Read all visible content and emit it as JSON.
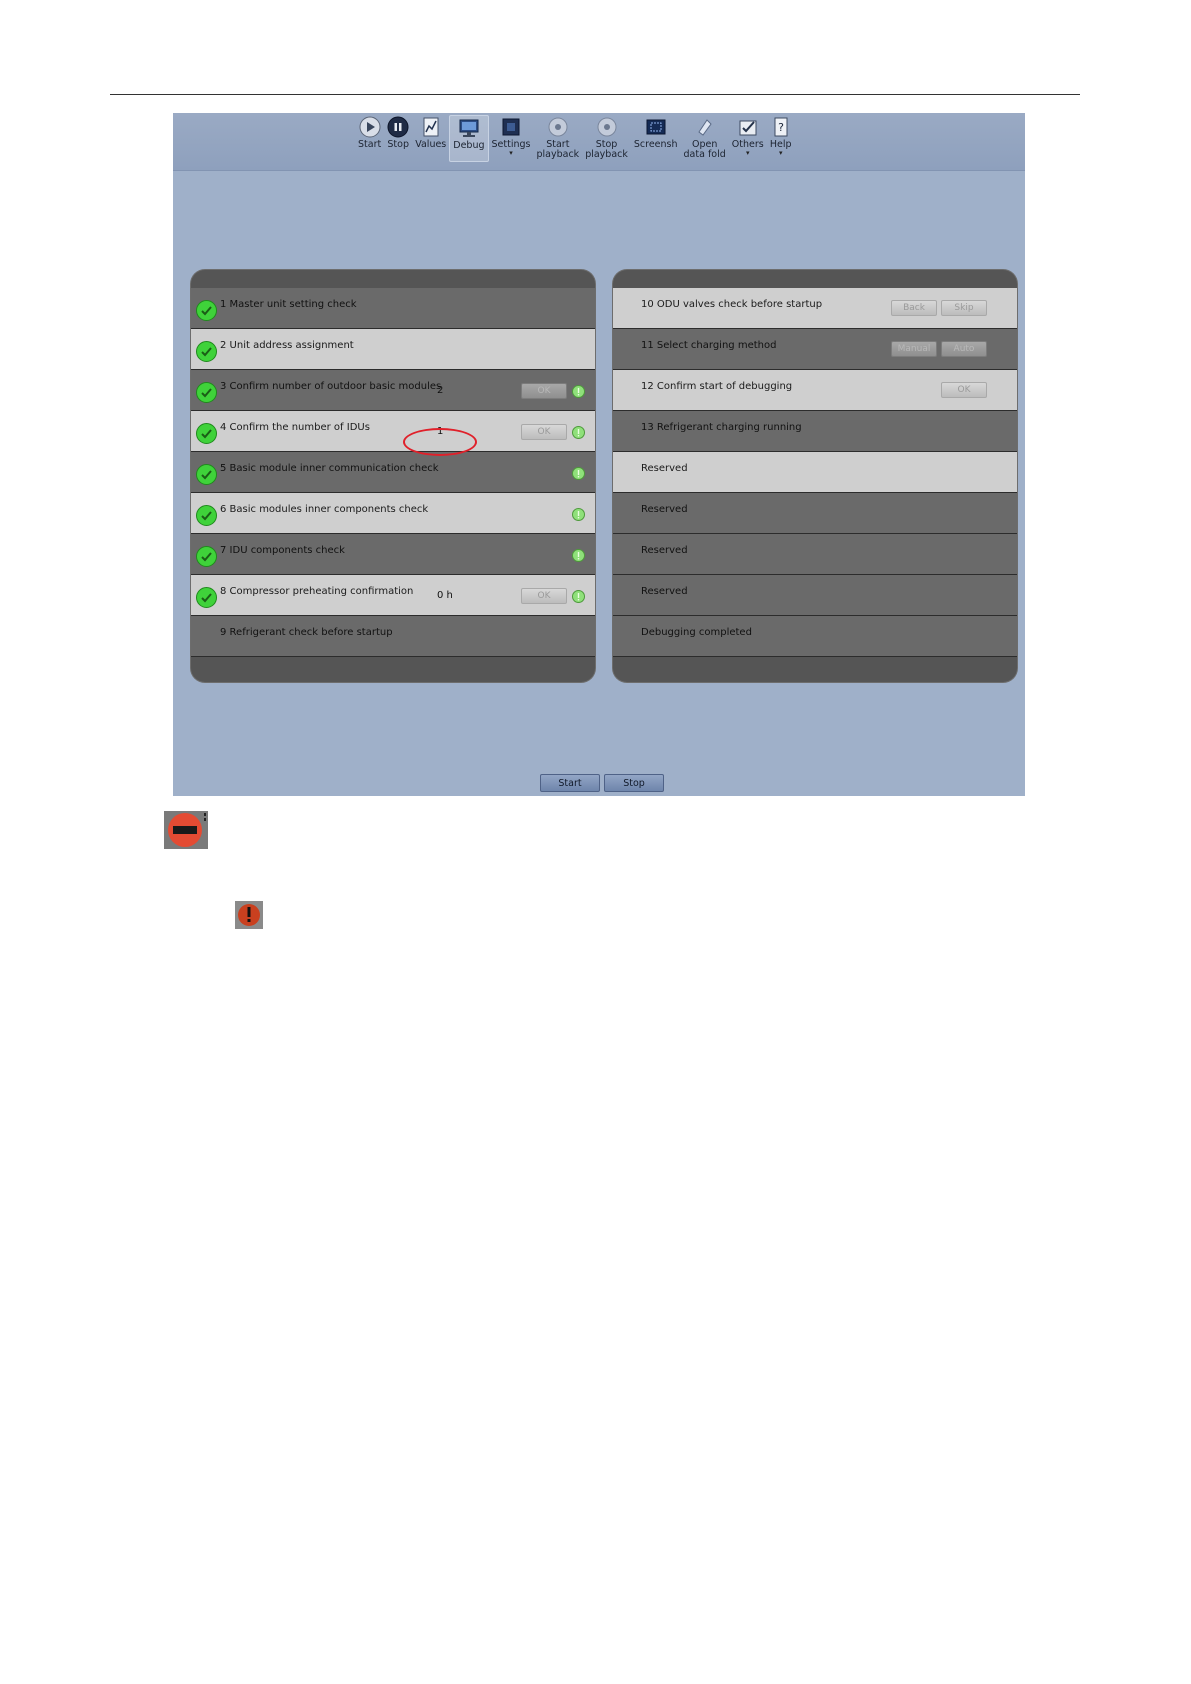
{
  "toolbar": {
    "items": [
      {
        "label": "Start",
        "icon": "start-icon",
        "active": false,
        "dropdown": false
      },
      {
        "label": "Stop",
        "icon": "stop-icon",
        "active": false,
        "dropdown": false
      },
      {
        "label": "Values",
        "icon": "values-icon",
        "active": false,
        "dropdown": false
      },
      {
        "label": "Debug",
        "icon": "debug-icon",
        "active": true,
        "dropdown": false
      },
      {
        "label": "Settings",
        "icon": "settings-icon",
        "active": false,
        "dropdown": true
      },
      {
        "label": "Start\nplayback",
        "icon": "start-playback-icon",
        "active": false,
        "dropdown": false
      },
      {
        "label": "Stop\nplayback",
        "icon": "stop-playback-icon",
        "active": false,
        "dropdown": false
      },
      {
        "label": "Screensh",
        "icon": "screenshot-icon",
        "active": false,
        "dropdown": false
      },
      {
        "label": "Open\ndata fold",
        "icon": "open-folder-icon",
        "active": false,
        "dropdown": false
      },
      {
        "label": "Others",
        "icon": "others-icon",
        "active": false,
        "dropdown": true
      },
      {
        "label": "Help",
        "icon": "help-icon",
        "active": false,
        "dropdown": true
      }
    ]
  },
  "left_steps": [
    {
      "label": "1 Master unit setting check",
      "done": true
    },
    {
      "label": "2 Unit address assignment",
      "done": true
    },
    {
      "label": "3 Confirm number of outdoor basic modules",
      "done": true,
      "value": "2",
      "button": "OK",
      "info": true
    },
    {
      "label": "4 Confirm the number of IDUs",
      "done": true,
      "value": "1",
      "button": "OK",
      "info": true
    },
    {
      "label": "5 Basic module inner communication check",
      "done": true,
      "info": true
    },
    {
      "label": "6 Basic modules inner components check",
      "done": true,
      "info": true
    },
    {
      "label": "7 IDU components check",
      "done": true,
      "info": true
    },
    {
      "label": "8 Compressor preheating confirmation",
      "done": true,
      "value": "0 h",
      "button": "OK",
      "info": true
    },
    {
      "label": "9 Refrigerant check before startup",
      "done": false
    }
  ],
  "right_steps": [
    {
      "label": "10 ODU valves check before startup",
      "buttons": [
        "Back",
        "Skip"
      ]
    },
    {
      "label": "11 Select charging method",
      "buttons": [
        "Manual",
        "Auto"
      ]
    },
    {
      "label": "12 Confirm start of debugging",
      "buttons": [
        "OK"
      ]
    },
    {
      "label": "13 Refrigerant charging running",
      "buttons": []
    },
    {
      "label": "Reserved",
      "buttons": []
    },
    {
      "label": "Reserved",
      "buttons": []
    },
    {
      "label": "Reserved",
      "buttons": []
    },
    {
      "label": "Reserved",
      "buttons": []
    },
    {
      "label": "Debugging completed",
      "buttons": []
    }
  ],
  "bottom": {
    "start_label": "Start",
    "stop_label": "Stop"
  },
  "colors": {
    "check_green": "#3fd23a",
    "info_green": "#8fe07a",
    "highlight_red": "#e0202a",
    "app_bg": "#9fb0c9"
  },
  "notes": {
    "stop_icon": "no-entry-icon",
    "warning_icon": "warning-icon"
  }
}
